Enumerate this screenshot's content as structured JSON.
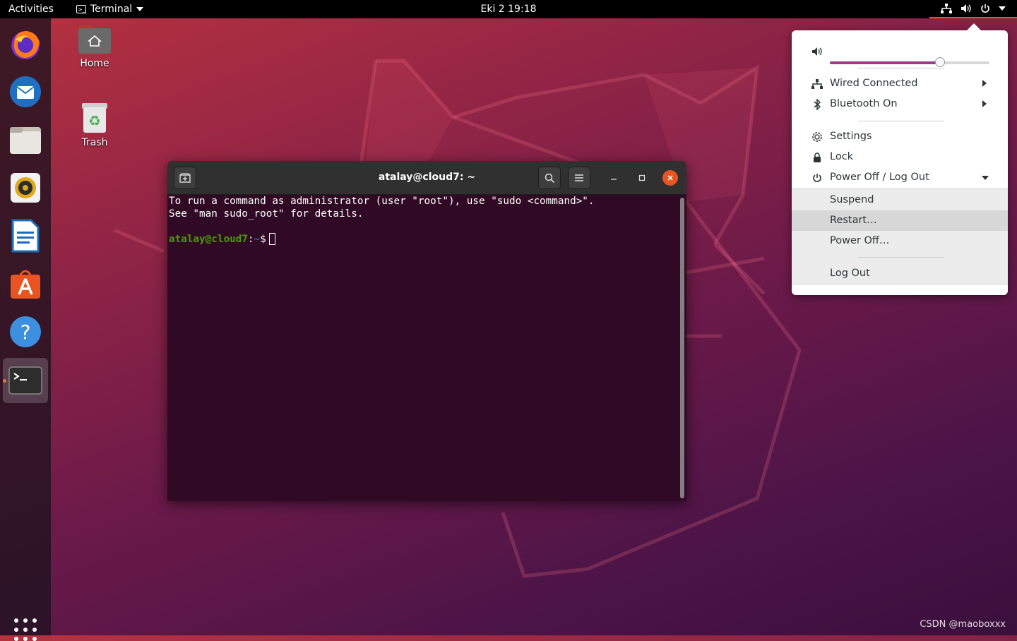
{
  "topbar": {
    "activities": "Activities",
    "app_name": "Terminal",
    "clock": "Eki 2  19:18"
  },
  "desktop": {
    "home_label": "Home",
    "trash_label": "Trash"
  },
  "terminal": {
    "title": "atalay@cloud7: ~",
    "line1": "To run a command as administrator (user \"root\"), use \"sudo <command>\".",
    "line2": "See \"man sudo_root\" for details.",
    "prompt_user": "atalay@cloud7",
    "prompt_sep": ":",
    "prompt_path": "~",
    "prompt_symbol": "$"
  },
  "system_menu": {
    "volume_level": 0.69,
    "wired": "Wired Connected",
    "bluetooth": "Bluetooth On",
    "settings": "Settings",
    "lock": "Lock",
    "power": "Power Off / Log Out",
    "suspend": "Suspend",
    "restart": "Restart…",
    "power_off": "Power Off…",
    "log_out": "Log Out"
  },
  "watermark": "CSDN @maoboxxx",
  "colors": {
    "accent": "#e95420",
    "terminal_bg": "#300a24",
    "prompt_user": "#4e9a06",
    "prompt_path": "#3465a4",
    "volume_fill": "#9b3c8d"
  }
}
